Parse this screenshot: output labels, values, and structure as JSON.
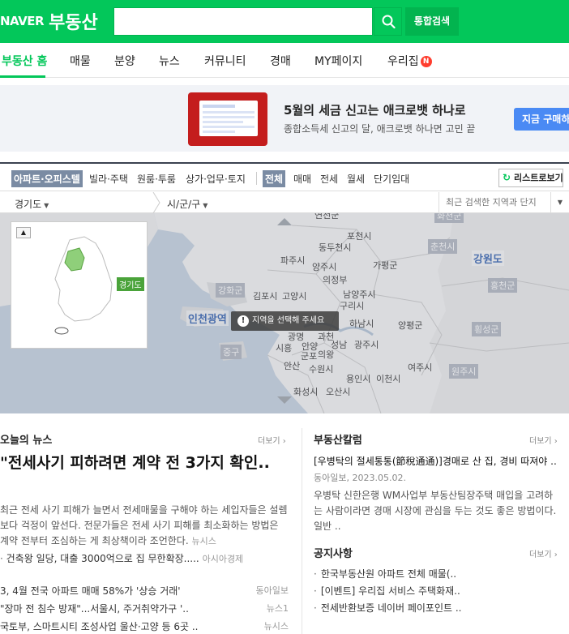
{
  "header": {
    "logo_naver": "NAVER",
    "logo_service": "부동산",
    "search_value": "",
    "integrated_search_label": "통합검색"
  },
  "nav": {
    "items": [
      "부동산 홈",
      "매물",
      "분양",
      "뉴스",
      "커뮤니티",
      "경매",
      "MY페이지",
      "우리집"
    ],
    "new_badge": "N"
  },
  "ad": {
    "title": "5월의 세금 신고는 애크로뱃 하나로",
    "desc": "종합소득세 신고의 달, 애크로뱃 하나면 고민 끝",
    "button": "지금 구매하"
  },
  "filters": {
    "property_tabs": [
      "아파트·오피스텔",
      "빌라·주택",
      "원룸·투룸",
      "상가·업무·토지"
    ],
    "deal_tabs": [
      "전체",
      "매매",
      "전세",
      "월세",
      "단기임대"
    ],
    "list_view_label": "리스트로보기"
  },
  "region": {
    "province": "경기도",
    "city": "시/군/구",
    "recent_label": "최근 검색한 지역과 단지"
  },
  "map": {
    "labels": {
      "pocheon": "포천시",
      "dongducheon": "동두천시",
      "yangju": "양주시",
      "paju": "파주시",
      "uijeongbu": "의정부",
      "gapyeong": "가평군",
      "chuncheon": "춘천시",
      "gangwon": "강원도",
      "hongcheon": "홍천군",
      "ganghwa": "강화군",
      "gimpo": "김포시",
      "goyang": "고양시",
      "namyangju": "남양주시",
      "guri": "구리시",
      "incheon": "인천광역",
      "hanam": "하남시",
      "yangpyeong": "양평군",
      "hoengseong": "횡성군",
      "junggu": "중구",
      "gwangmyeong": "광명",
      "gwacheon": "과천",
      "siheung": "시흥",
      "anyang": "안양",
      "seongnam": "성남",
      "gwangju": "광주시",
      "gunpo": "군포",
      "uiwang": "의왕",
      "ansan": "안산",
      "suwon": "수원시",
      "yongin": "용인시",
      "icheon": "이천시",
      "yeoju": "여주시",
      "wonju": "원주시",
      "hwaseong": "화성시",
      "osan": "오산시",
      "gyeonggi_tag": "경기도"
    },
    "toast": "지역을 선택해 주세요"
  },
  "news": {
    "title": "오늘의 뉴스",
    "more": "더보기 ›",
    "headline": "\"전세사기 피하려면 계약 전 3가지 확인..",
    "summary": "최근 전세 사기 피해가 늘면서 전세매물을 구해야 하는 세입자들은 설렘보다 걱정이 앞선다. 전문가들은 전세 사기 피해를 최소화하는 방법은 계약 전부터 조심하는 게 최상책이라 조언한다.",
    "summary_source": "뉴시스",
    "sub_headline": "건축왕 일당, 대출 3000억으로 집 무한확장.....",
    "sub_source": "아시아경제",
    "items": [
      {
        "title": "3, 4월 전국 아파트 매매 58%가 '상승 거래'",
        "press": "동아일보"
      },
      {
        "title": "\"장마 전 침수 방재\"...서울시, 주거취약가구 '..",
        "press": "뉴스1"
      },
      {
        "title": "국토부, 스마트시티 조성사업 울산·고양 등 6곳 ..",
        "press": "뉴시스"
      }
    ]
  },
  "column": {
    "title": "부동산칼럼",
    "more": "더보기 ›",
    "article_title": "[우병탁의 절세통통(節稅通通)]경매로 산 집, 경비 따져야 ..",
    "article_meta": "동아일보, 2023.05.02.",
    "article_body": "우병탁 신한은행 WM사업부 부동산팀장주택 매입을 고려하는 사람이라면 경매 시장에 관심을 두는 것도 좋은 방법이다. 일반 .."
  },
  "notice": {
    "title": "공지사항",
    "more": "더보기 ›",
    "items": [
      "한국부동산원 아파트 전체 매물(..",
      "[이벤트] 우리집 서비스 주택화재..",
      "전세반환보증 네이버 페이포인트 .."
    ]
  },
  "colors": {
    "brand_green": "#03c75a",
    "ad_button": "#4a8af4",
    "badge_red": "#ff3d2e"
  }
}
